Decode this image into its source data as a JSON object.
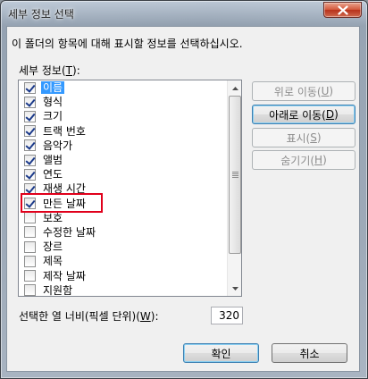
{
  "window": {
    "title": "세부 정보 선택"
  },
  "description": "이 폴더의 항목에 대해 표시할 정보를 선택하십시오.",
  "details_label": {
    "before": "세부 정보(",
    "key": "T",
    "after": "):"
  },
  "items": [
    {
      "label": "이름",
      "checked": true,
      "selected": true
    },
    {
      "label": "형식",
      "checked": true,
      "selected": false
    },
    {
      "label": "크기",
      "checked": true,
      "selected": false
    },
    {
      "label": "트랙 번호",
      "checked": true,
      "selected": false
    },
    {
      "label": "음악가",
      "checked": true,
      "selected": false
    },
    {
      "label": "앨범",
      "checked": true,
      "selected": false
    },
    {
      "label": "연도",
      "checked": true,
      "selected": false
    },
    {
      "label": "재생 시간",
      "checked": true,
      "selected": false
    },
    {
      "label": "만든 날짜",
      "checked": true,
      "selected": false
    },
    {
      "label": "보호",
      "checked": false,
      "selected": false
    },
    {
      "label": "수정한 날짜",
      "checked": false,
      "selected": false
    },
    {
      "label": "장르",
      "checked": false,
      "selected": false
    },
    {
      "label": "제목",
      "checked": false,
      "selected": false
    },
    {
      "label": "제작 날짜",
      "checked": false,
      "selected": false
    },
    {
      "label": "지원함",
      "checked": false,
      "selected": false
    }
  ],
  "buttons": {
    "move_up": {
      "before": "위로 이동(",
      "key": "U",
      "after": ")",
      "enabled": false
    },
    "move_down": {
      "before": "아래로 이동(",
      "key": "D",
      "after": ")",
      "enabled": true
    },
    "show": {
      "before": "표시(",
      "key": "S",
      "after": ")",
      "enabled": false
    },
    "hide": {
      "before": "숨기기(",
      "key": "H",
      "after": ")",
      "enabled": false
    },
    "ok": "확인",
    "cancel": "취소"
  },
  "column_width": {
    "label_before": "선택한 열 너비(픽셀 단위)(",
    "label_key": "W",
    "label_after": "):",
    "value": "320"
  },
  "highlighted_item": "만든 날짜",
  "colors": {
    "selection": "#3399ff",
    "highlight_box": "#e0001b"
  },
  "icons": {
    "close": "close-icon",
    "scroll_up": "scroll-up-arrow-icon",
    "scroll_down": "scroll-down-arrow-icon"
  }
}
